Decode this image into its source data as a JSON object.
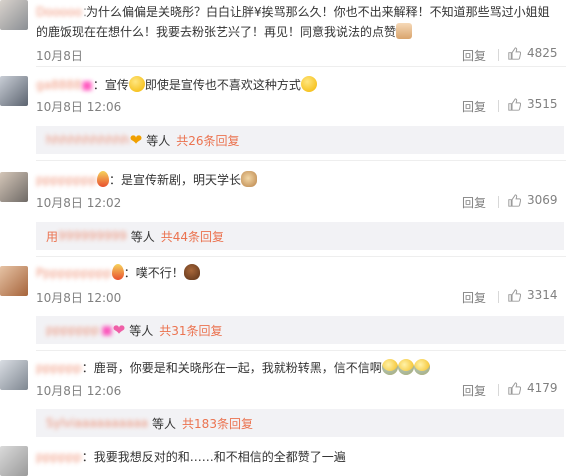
{
  "comments": [
    {
      "text_line1": "为什么偏偏是关晓彤？白白让胖¥挨骂那么久！你也不出来解释！不知道那些骂过小姐姐",
      "text_line2": "的鹿饭现在在想什么！我要去粉张艺兴了！再见！同意我说法的点赞",
      "time": "10月8日",
      "reply": "回复",
      "likes": "4825"
    },
    {
      "text_a": "宣传",
      "text_b": "即使是宣传也不喜欢这种方式",
      "time": "10月8日 12:06",
      "reply": "回复",
      "likes": "3515",
      "sub_suffix": "等人",
      "sub_link": "共26条回复"
    },
    {
      "text": "：是宣传新剧，明天学长",
      "time": "10月8日 12:02",
      "reply": "回复",
      "likes": "3069",
      "sub_name": "用",
      "sub_suffix": "等人",
      "sub_link": "共44条回复"
    },
    {
      "text": "：噗不行！",
      "time": "10月8日 12:00",
      "reply": "回复",
      "likes": "3314",
      "sub_suffix": "等人",
      "sub_link": "共31条回复"
    },
    {
      "text": "：鹿哥，你要是和关晓彤在一起，我就粉转黑，信不信啊",
      "time": "10月8日 12:06",
      "reply": "回复",
      "likes": "4179",
      "sub_suffix": "等人",
      "sub_link": "共183条回复"
    },
    {
      "text": "：我要我想反对的和……和不相信的全都赞了一遍"
    }
  ],
  "colors": {
    "link": "#eb7350",
    "meta": "#808080",
    "sub_bg": "#f2f2f5"
  },
  "icons": [
    "thumb-up-icon",
    "emoji-icon"
  ]
}
